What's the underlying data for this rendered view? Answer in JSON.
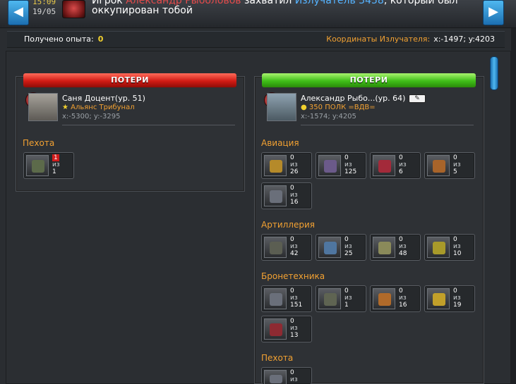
{
  "top": {
    "time": "15:09",
    "date": "19/05",
    "message_prefix": "Игрок ",
    "attacker": "Александр Рыболовов",
    "message_mid": " захватил ",
    "emitter": "Излучатель 3458",
    "message_suffix": ", который был оккупирован тобой",
    "prev_icon": "chevron-left-icon",
    "next_icon": "chevron-right-icon"
  },
  "summary": {
    "exp_label": "Получено опыта:",
    "exp_value": "0",
    "coords_label": "Координаты Излучателя:",
    "coords_value": "x:-1497; y:4203"
  },
  "left": {
    "header": "ПОТЕРИ",
    "player": "Саня Доцент(ур. 51)",
    "clan": "Альянс Трибунал",
    "coords": "x:-5300; y:-3295",
    "categories": [
      {
        "name": "Пехота",
        "units": [
          {
            "lost": "1",
            "of": "из",
            "total": "1"
          }
        ]
      }
    ]
  },
  "right": {
    "header": "ПОТЕРИ",
    "player": "Александр Рыбо...(ур. 64)",
    "clan": "350 ПОЛК =ВДВ=",
    "coords": "x:-1574; y:4205",
    "categories": [
      {
        "name": "Авиация",
        "units": [
          {
            "lost": "0",
            "of": "из",
            "total": "26"
          },
          {
            "lost": "0",
            "of": "из",
            "total": "125"
          },
          {
            "lost": "0",
            "of": "из",
            "total": "6"
          },
          {
            "lost": "0",
            "of": "из",
            "total": "5"
          },
          {
            "lost": "0",
            "of": "из",
            "total": "16"
          }
        ]
      },
      {
        "name": "Артиллерия",
        "units": [
          {
            "lost": "0",
            "of": "из",
            "total": "42"
          },
          {
            "lost": "0",
            "of": "из",
            "total": "25"
          },
          {
            "lost": "0",
            "of": "из",
            "total": "48"
          },
          {
            "lost": "0",
            "of": "из",
            "total": "10"
          }
        ]
      },
      {
        "name": "Бронетехника",
        "units": [
          {
            "lost": "0",
            "of": "из",
            "total": "151"
          },
          {
            "lost": "0",
            "of": "из",
            "total": "1"
          },
          {
            "lost": "0",
            "of": "из",
            "total": "16"
          },
          {
            "lost": "0",
            "of": "из",
            "total": "19"
          },
          {
            "lost": "0",
            "of": "из",
            "total": "13"
          }
        ]
      },
      {
        "name": "Пехота",
        "units": [
          {
            "lost": "0",
            "of": "из",
            "total": ""
          }
        ]
      }
    ]
  },
  "colors": {
    "accent": "#f2a132",
    "exp": "#f2d12e",
    "red_header": "#d11b14",
    "green_header": "#3fbe18",
    "link_blue": "#55b3ff",
    "attacker_red": "#e34b4b"
  }
}
